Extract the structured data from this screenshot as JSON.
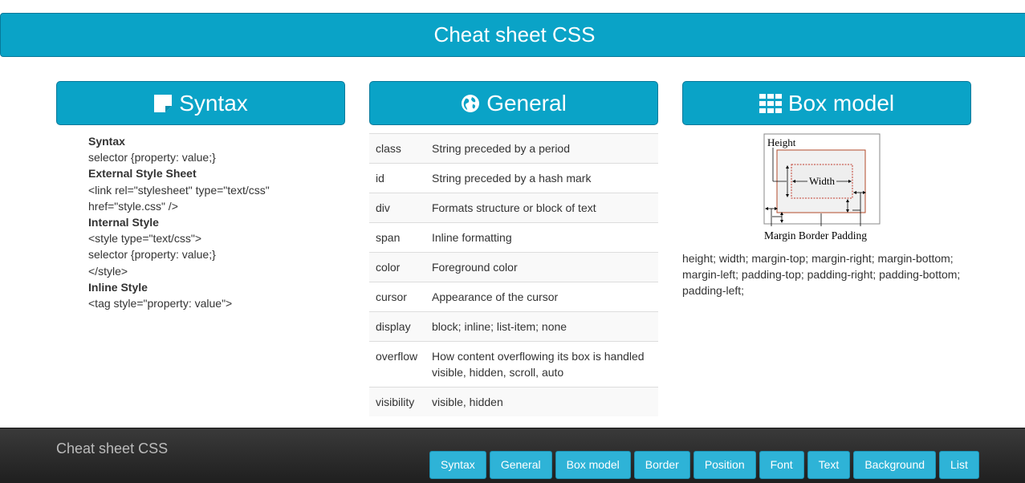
{
  "header": {
    "title": "Cheat sheet CSS"
  },
  "columns": {
    "syntax": {
      "title": "Syntax",
      "icon": "note-icon"
    },
    "general": {
      "title": "General",
      "icon": "globe-icon"
    },
    "box": {
      "title": "Box model",
      "icon": "grid-icon"
    }
  },
  "syntax": {
    "lines": [
      {
        "text": "Syntax",
        "bold": true
      },
      {
        "text": "selector {property: value;}",
        "bold": false
      },
      {
        "text": "External Style Sheet",
        "bold": true
      },
      {
        "text": "<link rel=\"stylesheet\" type=\"text/css\"",
        "bold": false
      },
      {
        "text": "href=\"style.css\" />",
        "bold": false
      },
      {
        "text": "Internal Style",
        "bold": true
      },
      {
        "text": "<style type=\"text/css\">",
        "bold": false
      },
      {
        "text": "selector {property: value;}",
        "bold": false
      },
      {
        "text": "</style>",
        "bold": false
      },
      {
        "text": "Inline Style",
        "bold": true
      },
      {
        "text": "<tag style=\"property: value\">",
        "bold": false
      }
    ]
  },
  "general": {
    "rows": [
      {
        "key": "class",
        "value": "String preceded by a period"
      },
      {
        "key": "id",
        "value": "String preceded by a hash mark"
      },
      {
        "key": "div",
        "value": "Formats structure or block of text"
      },
      {
        "key": "span",
        "value": "Inline formatting"
      },
      {
        "key": "color",
        "value": "Foreground color"
      },
      {
        "key": "cursor",
        "value": "Appearance of the cursor"
      },
      {
        "key": "display",
        "value": "block; inline; list-item; none"
      },
      {
        "key": "overflow",
        "value": "How content overflowing its box is handled\nvisible, hidden, scroll, auto"
      },
      {
        "key": "visibility",
        "value": "visible, hidden"
      }
    ]
  },
  "box_model": {
    "figure": {
      "height_label": "Height",
      "width_label": "Width",
      "bottom_labels": "Margin Border Padding"
    },
    "description": "height; width; margin-top; margin-right; margin-bottom; margin-left; padding-top; padding-right; padding-bottom; padding-left;"
  },
  "footer": {
    "title": "Cheat sheet CSS",
    "nav": [
      "Syntax",
      "General",
      "Box model",
      "Border",
      "Position",
      "Font",
      "Text",
      "Background",
      "List"
    ]
  },
  "colors": {
    "accent": "#0aa3c7",
    "nav_button": "#2eb3d7",
    "footer_bg": "#2a2a2a"
  }
}
